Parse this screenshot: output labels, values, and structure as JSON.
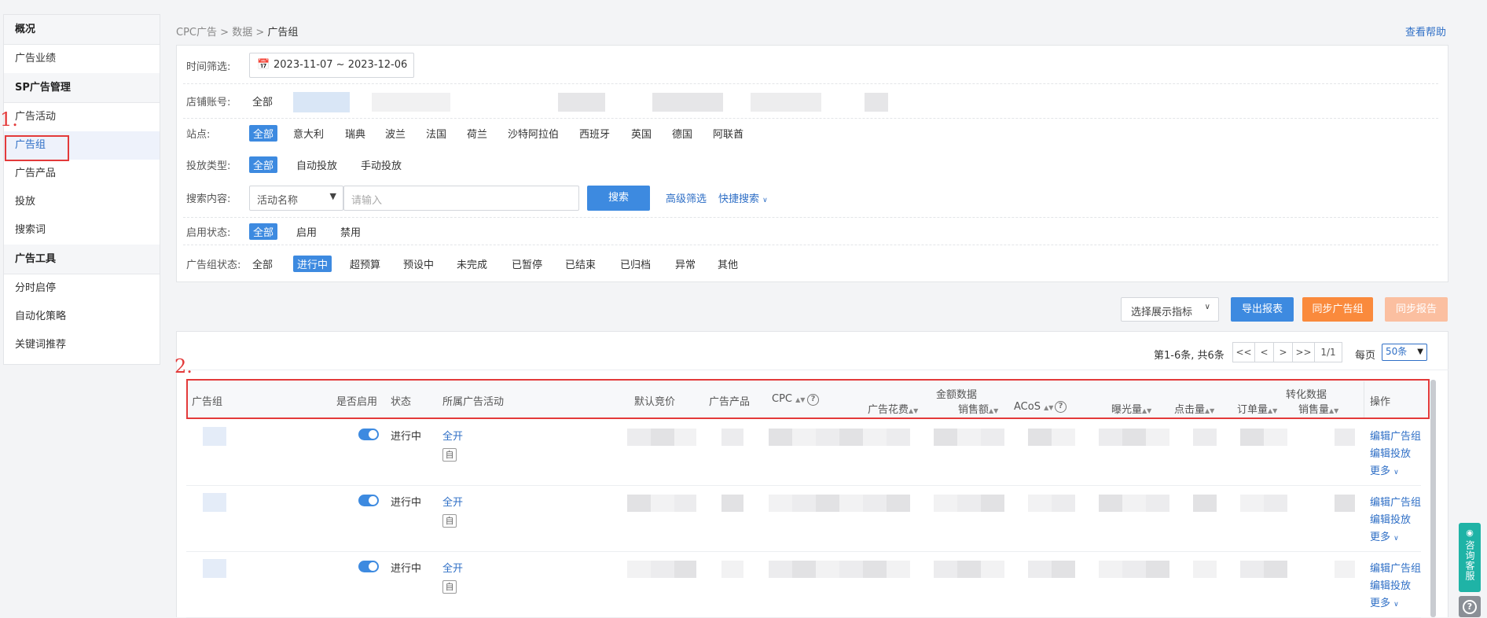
{
  "sidebar": {
    "groups": [
      {
        "title": "概况",
        "items": [
          "广告业绩"
        ]
      },
      {
        "title": "SP广告管理",
        "items": [
          "广告活动",
          "广告组",
          "广告产品",
          "投放",
          "搜索词"
        ]
      },
      {
        "title": "广告工具",
        "items": [
          "分时启停",
          "自动化策略",
          "关键词推荐"
        ]
      }
    ],
    "active_item": "广告组"
  },
  "annotations": {
    "marker1": "1.",
    "marker2": "2."
  },
  "breadcrumb": {
    "level1": "CPC广告",
    "level2": "数据",
    "level3": "广告组",
    "sep": ">"
  },
  "help_link": "查看帮助",
  "filters": {
    "time_label": "时间筛选:",
    "date_range": "2023-11-07 ~ 2023-12-06",
    "shop_label": "店铺账号:",
    "shop_all": "全部",
    "site_label": "站点:",
    "sites": [
      "全部",
      "意大利",
      "瑞典",
      "波兰",
      "法国",
      "荷兰",
      "沙特阿拉伯",
      "西班牙",
      "英国",
      "德国",
      "阿联酋"
    ],
    "type_label": "投放类型:",
    "types": [
      "全部",
      "自动投放",
      "手动投放"
    ],
    "search_label": "搜索内容:",
    "search_select": "活动名称",
    "search_placeholder": "请输入",
    "search_button": "搜索",
    "advanced": "高级筛选",
    "quick": "快捷搜索",
    "enable_label": "启用状态:",
    "enables": [
      "全部",
      "启用",
      "禁用"
    ],
    "group_status_label": "广告组状态:",
    "group_statuses": [
      "全部",
      "进行中",
      "超预算",
      "预设中",
      "未完成",
      "已暂停",
      "已结束",
      "已归档",
      "异常",
      "其他"
    ]
  },
  "toolbar": {
    "metrics": "选择展示指标",
    "export": "导出报表",
    "sync_group": "同步广告组",
    "sync_report": "同步报告",
    "export_color": "#3d8ae0",
    "sync_group_color": "#fa8a3c",
    "sync_report_color": "#fbbfa0"
  },
  "pagination": {
    "summary": "第1-6条, 共6条",
    "first": "<<",
    "prev": "<",
    "next": ">",
    "last": ">>",
    "page": "1/1",
    "per_page_label": "每页",
    "per_page": "50条"
  },
  "table": {
    "headers": {
      "group": "广告组",
      "enabled": "是否启用",
      "status": "状态",
      "campaign": "所属广告活动",
      "bid": "默认竞价",
      "products": "广告产品",
      "cpc": "CPC",
      "amount_group": "金额数据",
      "spend": "广告花费",
      "sales": "销售额",
      "acos": "ACoS",
      "impressions": "曝光量",
      "clicks": "点击量",
      "orders": "订单量",
      "conv_group": "转化数据",
      "units": "销售量",
      "actions": "操作"
    },
    "rows": [
      {
        "status": "进行中",
        "campaign": "全开",
        "tag": "自",
        "actions": [
          "编辑广告组",
          "编辑投放",
          "更多"
        ]
      },
      {
        "status": "进行中",
        "campaign": "全开",
        "tag": "自",
        "actions": [
          "编辑广告组",
          "编辑投放",
          "更多"
        ]
      },
      {
        "status": "进行中",
        "campaign": "全开",
        "tag": "自",
        "actions": [
          "编辑广告组",
          "编辑投放",
          "更多"
        ]
      }
    ]
  },
  "float_widget": {
    "consult": "咨询客服",
    "help": "?"
  }
}
